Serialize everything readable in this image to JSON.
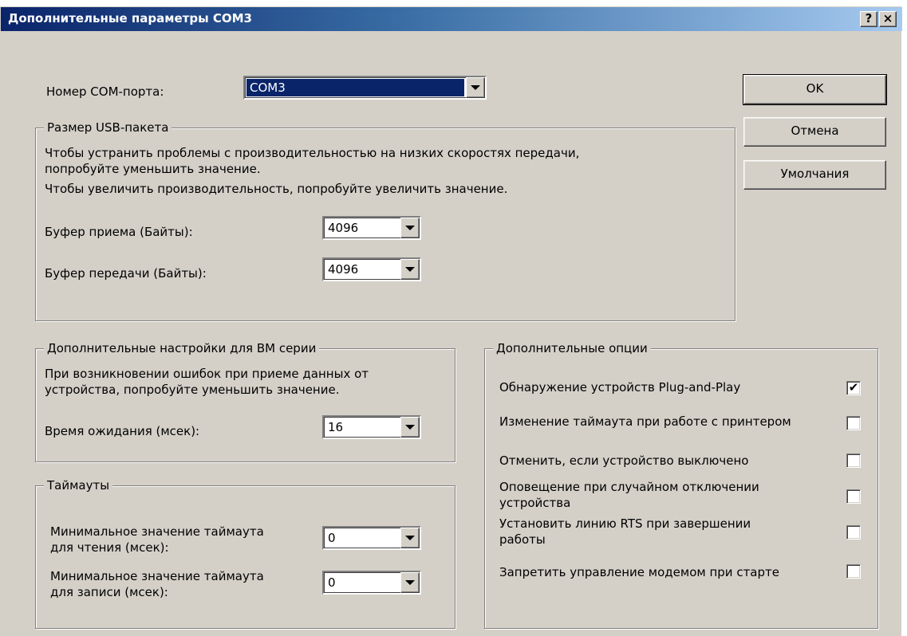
{
  "window": {
    "title": "Дополнительные параметры COM3",
    "help_label": "?",
    "close_label": "×"
  },
  "com_port": {
    "label": "Номер COM-порта:",
    "value": "COM3"
  },
  "buttons": {
    "ok": "OK",
    "cancel": "Отмена",
    "defaults": "Умолчания"
  },
  "usb_packet": {
    "title": "Размер USB-пакета",
    "desc1_line1": "Чтобы устранить проблемы с производительностью на низких скоростях передачи,",
    "desc1_line2": "попробуйте уменьшить значение.",
    "desc2": "Чтобы увеличить производительность, попробуйте увеличить значение.",
    "rx_label": "Буфер приема (Байты):",
    "rx_value": "4096",
    "tx_label": "Буфер передачи (Байты):",
    "tx_value": "4096"
  },
  "bm_settings": {
    "title": "Дополнительные настройки для BM серии",
    "desc_line1": "При возникновении ошибок при приеме данных от",
    "desc_line2": "устройства, попробуйте уменьшить значение.",
    "latency_label": "Время ожидания (мсек):",
    "latency_value": "16"
  },
  "timeouts": {
    "title": "Таймауты",
    "read_label_line1": "Минимальное значение таймаута",
    "read_label_line2": "для чтения (мсек):",
    "read_value": "0",
    "write_label_line1": "Минимальное значение таймаута",
    "write_label_line2": "для записи (мсек):",
    "write_value": "0"
  },
  "options": {
    "title": "Дополнительные опции",
    "items": [
      {
        "line1": "Обнаружение устройств Plug-and-Play",
        "line2": "",
        "checked": true,
        "mark": "✔"
      },
      {
        "line1": "Изменение таймаута при работе с принтером",
        "line2": "",
        "checked": false,
        "mark": ""
      },
      {
        "line1": "Отменить, если устройство выключено",
        "line2": "",
        "checked": false,
        "mark": ""
      },
      {
        "line1": "Оповещение при случайном отключении",
        "line2": "устройства",
        "checked": false,
        "mark": ""
      },
      {
        "line1": "Установить линию RTS при завершении",
        "line2": "работы",
        "checked": false,
        "mark": ""
      },
      {
        "line1": "Запретить управление модемом при старте",
        "line2": "",
        "checked": false,
        "mark": ""
      }
    ]
  },
  "colors": {
    "titlebar_start": "#0a246a",
    "titlebar_end": "#a6caf0",
    "dialog_bg": "#d4d0c8",
    "selection_bg": "#0a246a"
  }
}
